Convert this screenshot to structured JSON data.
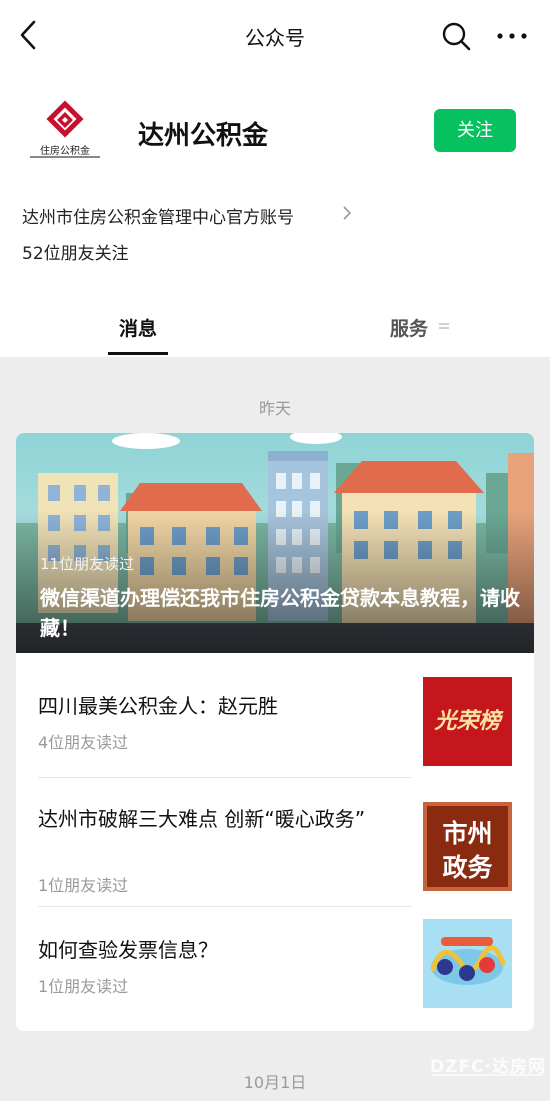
{
  "nav": {
    "title": "公众号"
  },
  "account": {
    "logo_text": "住房公积金",
    "name": "达州公积金",
    "follow_label": "关注",
    "description": "达州市住房公积金管理中心官方账号",
    "friends_following": "52位朋友关注"
  },
  "tabs": [
    {
      "label": "消息",
      "active": true
    },
    {
      "label": "服务",
      "active": false
    }
  ],
  "feed": {
    "date_yesterday": "昨天",
    "featured": {
      "reads": "11位朋友读过",
      "title": "微信渠道办理偿还我市住房公积金贷款本息教程，请收藏！"
    },
    "items": [
      {
        "title": "四川最美公积金人：赵元胜",
        "reads": "4位朋友读过",
        "thumb_text": "光荣榜"
      },
      {
        "title": "达州市破解三大难点 创新“暖心政务”",
        "reads": "1位朋友读过",
        "thumb_line1": "市州",
        "thumb_line2": "政务"
      },
      {
        "title": "如何查验发票信息？",
        "reads": "1位朋友读过"
      }
    ],
    "date_next": "10月1日"
  },
  "watermark": "DZFC·达房网",
  "colors": {
    "accent": "#07c160",
    "feed_bg": "#ededed"
  }
}
